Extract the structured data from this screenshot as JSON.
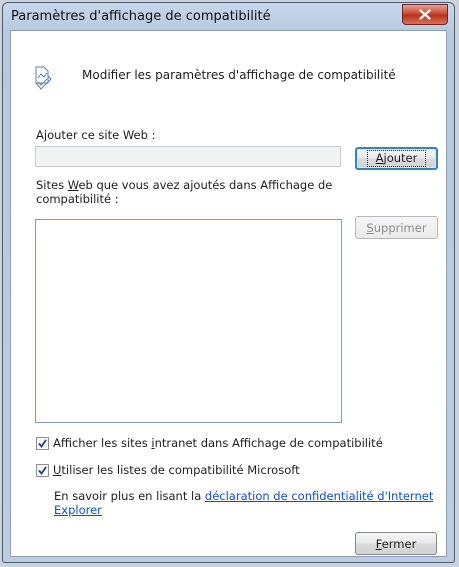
{
  "window": {
    "title": "Paramètres d'affichage de compatibilité"
  },
  "header": {
    "text": "Modifier les paramètres d'affichage de compatibilité",
    "icon": "compat-view-icon"
  },
  "add_site": {
    "label_pre": "A",
    "label_ul": "j",
    "label_post": "outer ce site Web :",
    "input_value": "",
    "button": {
      "pre": "",
      "ul": "A",
      "post": "jouter"
    }
  },
  "sites_list": {
    "label_pre": "Sites ",
    "label_ul": "W",
    "label_post": "eb que vous avez ajoutés dans Affichage de compatibilité :",
    "items": [],
    "remove_button": {
      "pre": "",
      "ul": "S",
      "post": "upprimer"
    }
  },
  "options": {
    "intranet": {
      "checked": true,
      "pre": "Afficher les sites ",
      "ul": "i",
      "post": "ntranet dans Affichage de compatibilité"
    },
    "ms_lists": {
      "checked": true,
      "pre": "",
      "ul": "U",
      "post": "tiliser les listes de compatibilité Microsoft"
    }
  },
  "info": {
    "text": "En savoir plus en lisant la ",
    "link": "déclaration de confidentialité d'Internet Explorer"
  },
  "footer": {
    "close_button": {
      "pre": "",
      "ul": "F",
      "post": "ermer"
    }
  },
  "colors": {
    "link": "#0b52c4",
    "focus": "#3c7fb1",
    "close_red": "#c94a33"
  }
}
